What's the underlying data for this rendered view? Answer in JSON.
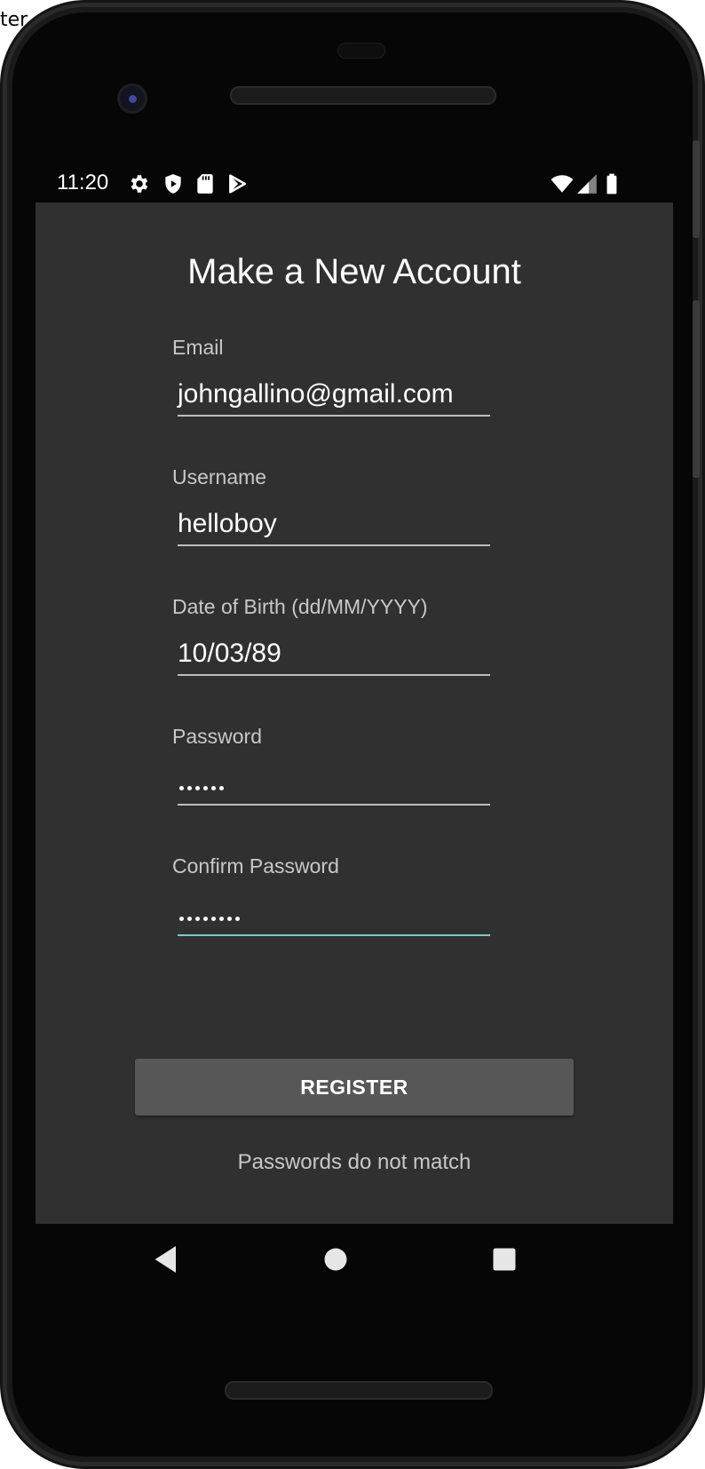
{
  "background": {
    "fragment_top": "ter"
  },
  "statusbar": {
    "time": "11:20",
    "icons": [
      "gear-icon",
      "shield-icon",
      "sd-card-icon",
      "play-store-icon",
      "wifi-icon",
      "signal-icon",
      "battery-icon"
    ]
  },
  "form": {
    "title": "Make a New Account",
    "fields": [
      {
        "label": "Email",
        "value": "johngallino@gmail.com",
        "type": "text",
        "focused": false
      },
      {
        "label": "Username",
        "value": "helloboy",
        "type": "text",
        "focused": false
      },
      {
        "label": "Date of Birth (dd/MM/YYYY)",
        "value": "10/03/89",
        "type": "text",
        "focused": false
      },
      {
        "label": "Password",
        "value": "••••••",
        "type": "password",
        "length": 6,
        "focused": false
      },
      {
        "label": "Confirm Password",
        "value": "••••••••",
        "type": "password",
        "length": 8,
        "focused": true
      }
    ],
    "register_label": "REGISTER",
    "error_message": "Passwords do not match"
  },
  "navbar": {
    "icons": [
      "back-icon",
      "home-icon",
      "recents-icon"
    ]
  },
  "colors": {
    "screen_background": "#303030",
    "focus_underline": "#80cbc4",
    "button_background": "#575757"
  }
}
